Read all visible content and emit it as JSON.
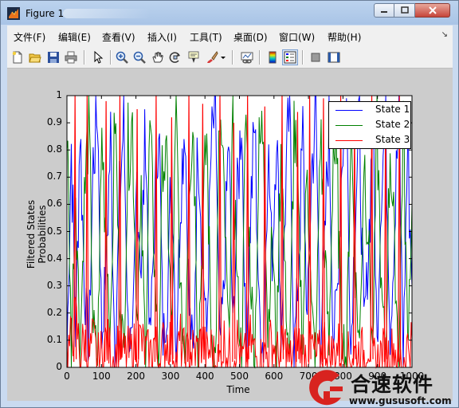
{
  "window": {
    "title": "Figure 1"
  },
  "menu": [
    "文件(F)",
    "编辑(E)",
    "查看(V)",
    "插入(I)",
    "工具(T)",
    "桌面(D)",
    "窗口(W)",
    "帮助(H)"
  ],
  "toolbar": {
    "icons": [
      "new-figure-icon",
      "open-file-icon",
      "save-icon",
      "print-icon",
      "edit-plot-arrow-icon",
      "zoom-in-icon",
      "zoom-out-icon",
      "pan-hand-icon",
      "rotate-3d-icon",
      "data-cursor-icon",
      "brush-icon",
      "brush-dropdown-icon",
      "link-plot-icon",
      "colorbar-icon",
      "legend-icon",
      "hide-plot-tools-icon",
      "show-plot-tools-icon"
    ]
  },
  "colors": {
    "state1": "#0000ff",
    "state2": "#008000",
    "state3": "#ff0000"
  },
  "chart_data": {
    "type": "line",
    "title": "",
    "xlabel": "Time",
    "ylabel": "Filtered States Probabilities",
    "xlim": [
      0,
      1000
    ],
    "ylim": [
      0,
      1
    ],
    "x_ticks": [
      "0",
      "100",
      "200",
      "300",
      "400",
      "500",
      "600",
      "700",
      "800",
      "900",
      "1000"
    ],
    "y_ticks": [
      "0",
      "0.1",
      "0.2",
      "0.3",
      "0.4",
      "0.5",
      "0.6",
      "0.7",
      "0.8",
      "0.9",
      "1"
    ],
    "legend_position": "top-right",
    "grid": false,
    "series": [
      {
        "name": "State 1",
        "color": "#0000ff",
        "values": [
          0.05,
          0.82,
          0.12,
          0.9,
          0.3,
          0.05,
          0.75,
          0.95,
          0.1,
          0.4,
          0.85,
          0.02,
          0.6,
          0.92,
          0.15,
          0.05,
          0.7,
          0.35,
          0.9,
          0.08,
          0.5,
          0.96,
          0.1,
          0.25,
          0.8,
          0.05,
          0.65,
          0.93,
          0.2,
          0.04,
          0.88,
          0.45,
          0.1,
          0.78,
          0.97,
          0.06,
          0.3,
          0.85,
          0.12,
          0.6,
          0.95,
          0.03,
          0.55,
          0.9,
          0.2,
          0.07,
          0.82,
          0.4,
          0.92,
          0.1,
          0.62,
          0.98,
          0.05,
          0.35,
          0.86,
          0.15,
          0.72,
          0.94,
          0.08,
          0.45,
          0.9,
          0.1,
          0.3,
          0.8,
          0.96,
          0.05,
          0.6,
          0.88,
          0.15,
          0.4,
          0.93,
          0.07,
          0.7,
          0.9,
          0.12,
          0.5,
          0.97,
          0.04,
          0.82,
          0.3
        ]
      },
      {
        "name": "State 2",
        "color": "#008000",
        "values": [
          0.9,
          0.08,
          0.7,
          0.05,
          0.6,
          0.92,
          0.15,
          0.03,
          0.85,
          0.5,
          0.1,
          0.95,
          0.3,
          0.04,
          0.8,
          0.9,
          0.2,
          0.55,
          0.05,
          0.88,
          0.4,
          0.02,
          0.82,
          0.65,
          0.1,
          0.93,
          0.25,
          0.04,
          0.75,
          0.9,
          0.06,
          0.45,
          0.86,
          0.15,
          0.02,
          0.92,
          0.6,
          0.1,
          0.84,
          0.3,
          0.03,
          0.94,
          0.35,
          0.05,
          0.78,
          0.9,
          0.12,
          0.5,
          0.04,
          0.85,
          0.3,
          0.01,
          0.9,
          0.55,
          0.08,
          0.8,
          0.2,
          0.03,
          0.88,
          0.45,
          0.06,
          0.85,
          0.62,
          0.15,
          0.02,
          0.9,
          0.35,
          0.07,
          0.8,
          0.5,
          0.04,
          0.92,
          0.25,
          0.06,
          0.84,
          0.42,
          0.02,
          0.93,
          0.1,
          0.6
        ]
      },
      {
        "name": "State 3",
        "color": "#ff0000",
        "values": [
          0.05,
          0.1,
          0.18,
          0.05,
          0.1,
          0.03,
          0.1,
          0.02,
          0.05,
          0.1,
          0.05,
          0.03,
          0.1,
          0.04,
          0.05,
          0.05,
          0.1,
          0.1,
          0.05,
          0.04,
          0.1,
          0.02,
          0.08,
          0.1,
          0.1,
          0.02,
          0.1,
          0.03,
          0.05,
          0.06,
          0.06,
          0.1,
          0.04,
          0.07,
          0.01,
          0.02,
          0.1,
          0.05,
          0.04,
          0.1,
          0.02,
          0.03,
          0.1,
          0.05,
          0.02,
          0.03,
          0.06,
          0.1,
          0.04,
          0.05,
          0.08,
          0.01,
          0.05,
          0.1,
          0.06,
          0.05,
          0.08,
          0.03,
          0.04,
          0.1,
          0.04,
          0.05,
          0.08,
          0.05,
          0.02,
          0.05,
          0.05,
          0.05,
          0.05,
          0.1,
          0.03,
          0.01,
          0.05,
          0.04,
          0.04,
          0.08,
          0.01,
          0.03,
          0.08,
          0.1
        ],
        "spikes": [
          [
            20,
            1.0
          ],
          [
            55,
            1.0
          ],
          [
            110,
            0.98
          ],
          [
            150,
            1.0
          ],
          [
            200,
            0.95
          ],
          [
            255,
            1.0
          ],
          [
            300,
            0.92
          ],
          [
            350,
            1.0
          ],
          [
            390,
            0.97
          ],
          [
            440,
            1.0
          ],
          [
            480,
            0.9
          ],
          [
            520,
            1.0
          ],
          [
            570,
            0.96
          ],
          [
            620,
            1.0
          ],
          [
            665,
            0.94
          ],
          [
            700,
            1.0
          ],
          [
            740,
            0.99
          ],
          [
            790,
            1.0
          ],
          [
            830,
            0.93
          ],
          [
            880,
            1.0
          ],
          [
            920,
            0.97
          ],
          [
            960,
            1.0
          ]
        ]
      }
    ]
  },
  "watermark": {
    "text": "合速软件",
    "url": "www.gususoft.com"
  }
}
